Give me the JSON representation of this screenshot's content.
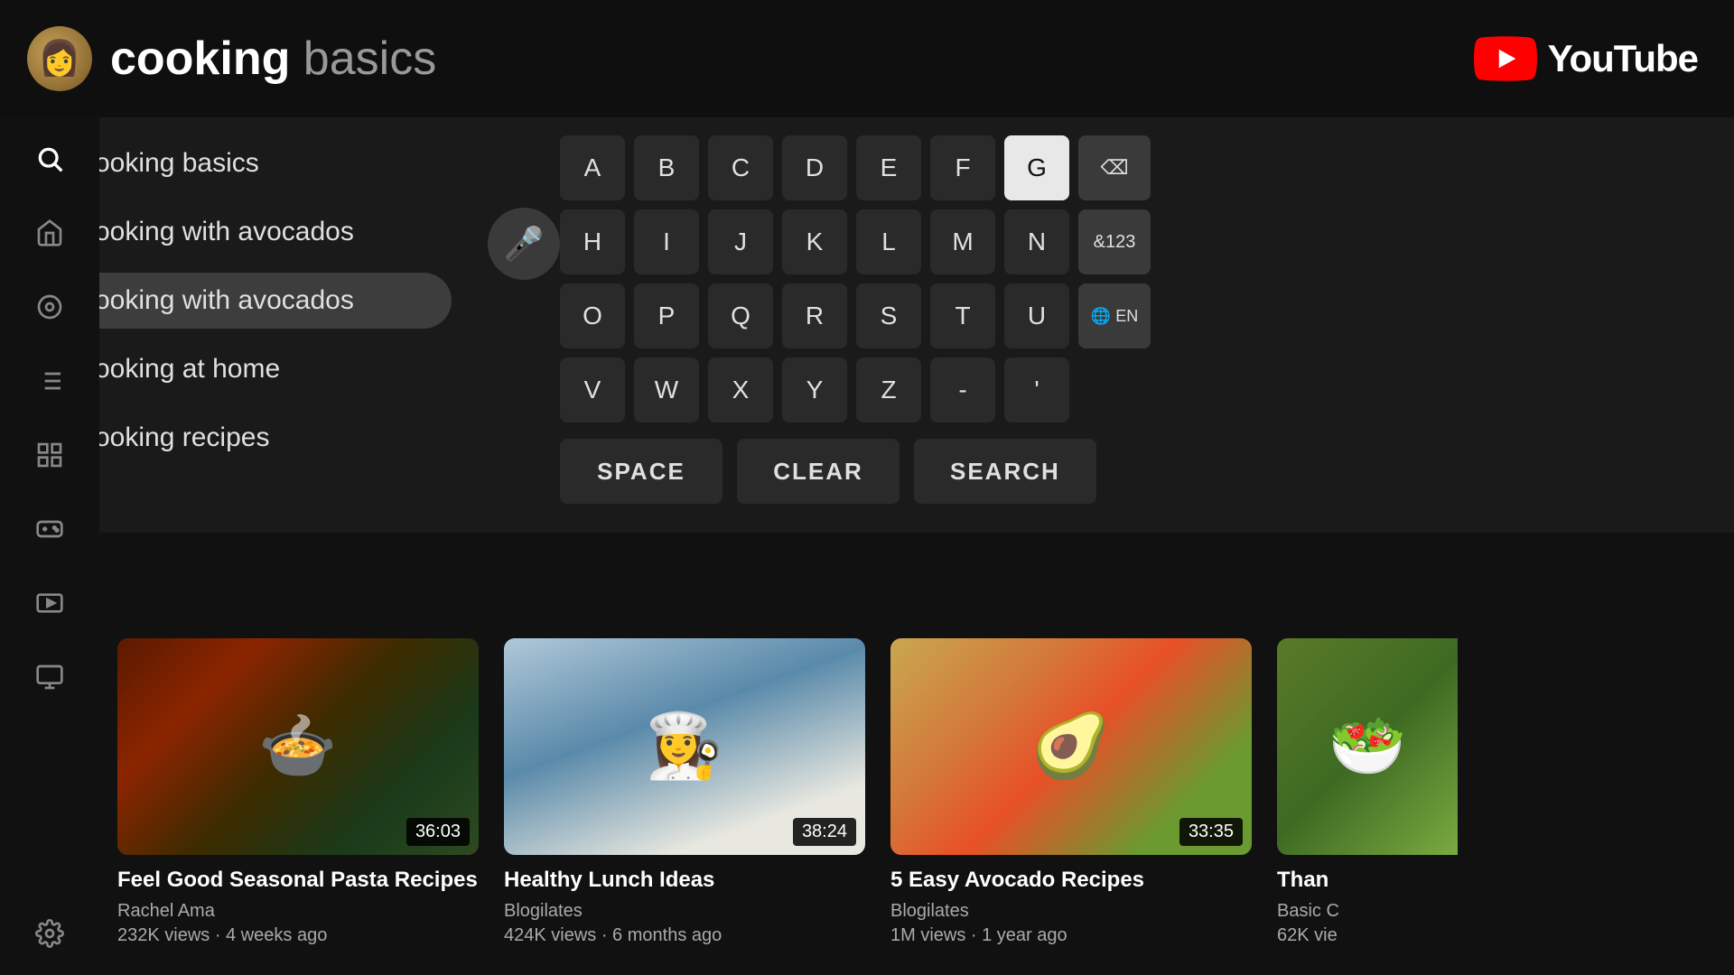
{
  "header": {
    "title_bold": "cooking ",
    "title_light": "basics",
    "youtube_label": "YouTube"
  },
  "sidebar": {
    "icons": [
      {
        "name": "search",
        "symbol": "🔍",
        "active": true
      },
      {
        "name": "home",
        "symbol": "⌂",
        "active": false
      },
      {
        "name": "play-circle",
        "symbol": "▶",
        "active": false
      },
      {
        "name": "list",
        "symbol": "⋮",
        "active": false
      },
      {
        "name": "grid",
        "symbol": "▦",
        "active": false
      },
      {
        "name": "game",
        "symbol": "🎮",
        "active": false
      },
      {
        "name": "queue",
        "symbol": "▤",
        "active": false
      },
      {
        "name": "subscriptions",
        "symbol": "📋",
        "active": false
      },
      {
        "name": "settings",
        "symbol": "⚙",
        "active": false
      }
    ]
  },
  "suggestions": [
    {
      "text": "cooking basics",
      "has_history": true,
      "active": false
    },
    {
      "text": "cooking with avocados",
      "has_history": true,
      "active": false
    },
    {
      "text": "cooking with avocados",
      "has_history": false,
      "active": true
    },
    {
      "text": "cooking at home",
      "has_history": false,
      "active": false
    },
    {
      "text": "cooking recipes",
      "has_history": false,
      "active": false
    }
  ],
  "keyboard": {
    "rows": [
      [
        "A",
        "B",
        "C",
        "D",
        "E",
        "F",
        "G",
        "⌫"
      ],
      [
        "H",
        "I",
        "J",
        "K",
        "L",
        "M",
        "N",
        "&123"
      ],
      [
        "O",
        "P",
        "Q",
        "R",
        "S",
        "T",
        "U",
        "🌐 EN"
      ],
      [
        "V",
        "W",
        "X",
        "Y",
        "Z",
        "-",
        "'"
      ]
    ],
    "active_key": "G",
    "bottom_buttons": [
      "SPACE",
      "CLEAR",
      "SEARCH"
    ]
  },
  "videos": [
    {
      "title": "Feel Good Seasonal Pasta Recipes",
      "channel": "Rachel Ama",
      "meta": "232K views · 4 weeks ago",
      "duration": "36:03",
      "thumb_class": "thumb-pasta"
    },
    {
      "title": "Healthy Lunch Ideas",
      "channel": "Blogilates",
      "meta": "424K views · 6 months ago",
      "duration": "38:24",
      "thumb_class": "thumb-healthy"
    },
    {
      "title": "5 Easy Avocado Recipes",
      "channel": "Blogilates",
      "meta": "1M views · 1 year ago",
      "duration": "33:35",
      "thumb_class": "thumb-avocado"
    },
    {
      "title": "Than",
      "channel": "Basic C",
      "meta": "62K vie",
      "duration": "",
      "thumb_class": "thumb-partial",
      "partial": true
    }
  ],
  "voice": {
    "icon": "🎤"
  }
}
